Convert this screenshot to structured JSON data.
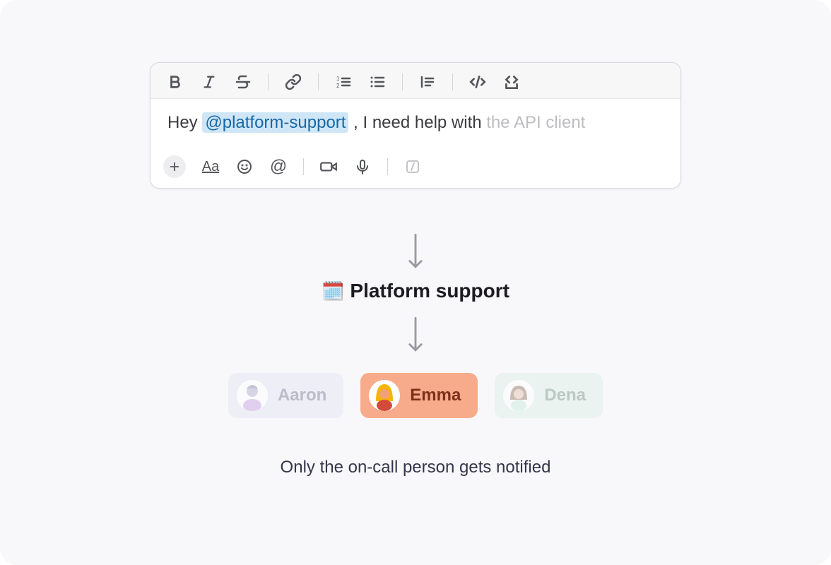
{
  "message": {
    "prefix": "Hey ",
    "mention": "@platform-support",
    "suffix": " , I need help with ",
    "suffix_fade": "the API client"
  },
  "schedule": {
    "icon": "🗓️",
    "title": "Platform support"
  },
  "users": [
    {
      "name": "Aaron",
      "active": false,
      "chipClass": "chip-aaron"
    },
    {
      "name": "Emma",
      "active": true,
      "chipClass": "chip-emma"
    },
    {
      "name": "Dena",
      "active": false,
      "chipClass": "chip-dena"
    }
  ],
  "caption": "Only the on-call person gets notified",
  "toolbar_top_icons": [
    "bold-icon",
    "italic-icon",
    "strikethrough-icon",
    "link-icon",
    "ordered-list-icon",
    "bullet-list-icon",
    "blockquote-icon",
    "code-icon",
    "code-block-icon"
  ],
  "toolbar_bottom_icons": [
    "attach-plus-icon",
    "text-format-icon",
    "emoji-icon",
    "mention-icon",
    "video-icon",
    "audio-icon",
    "shortcut-icon"
  ]
}
